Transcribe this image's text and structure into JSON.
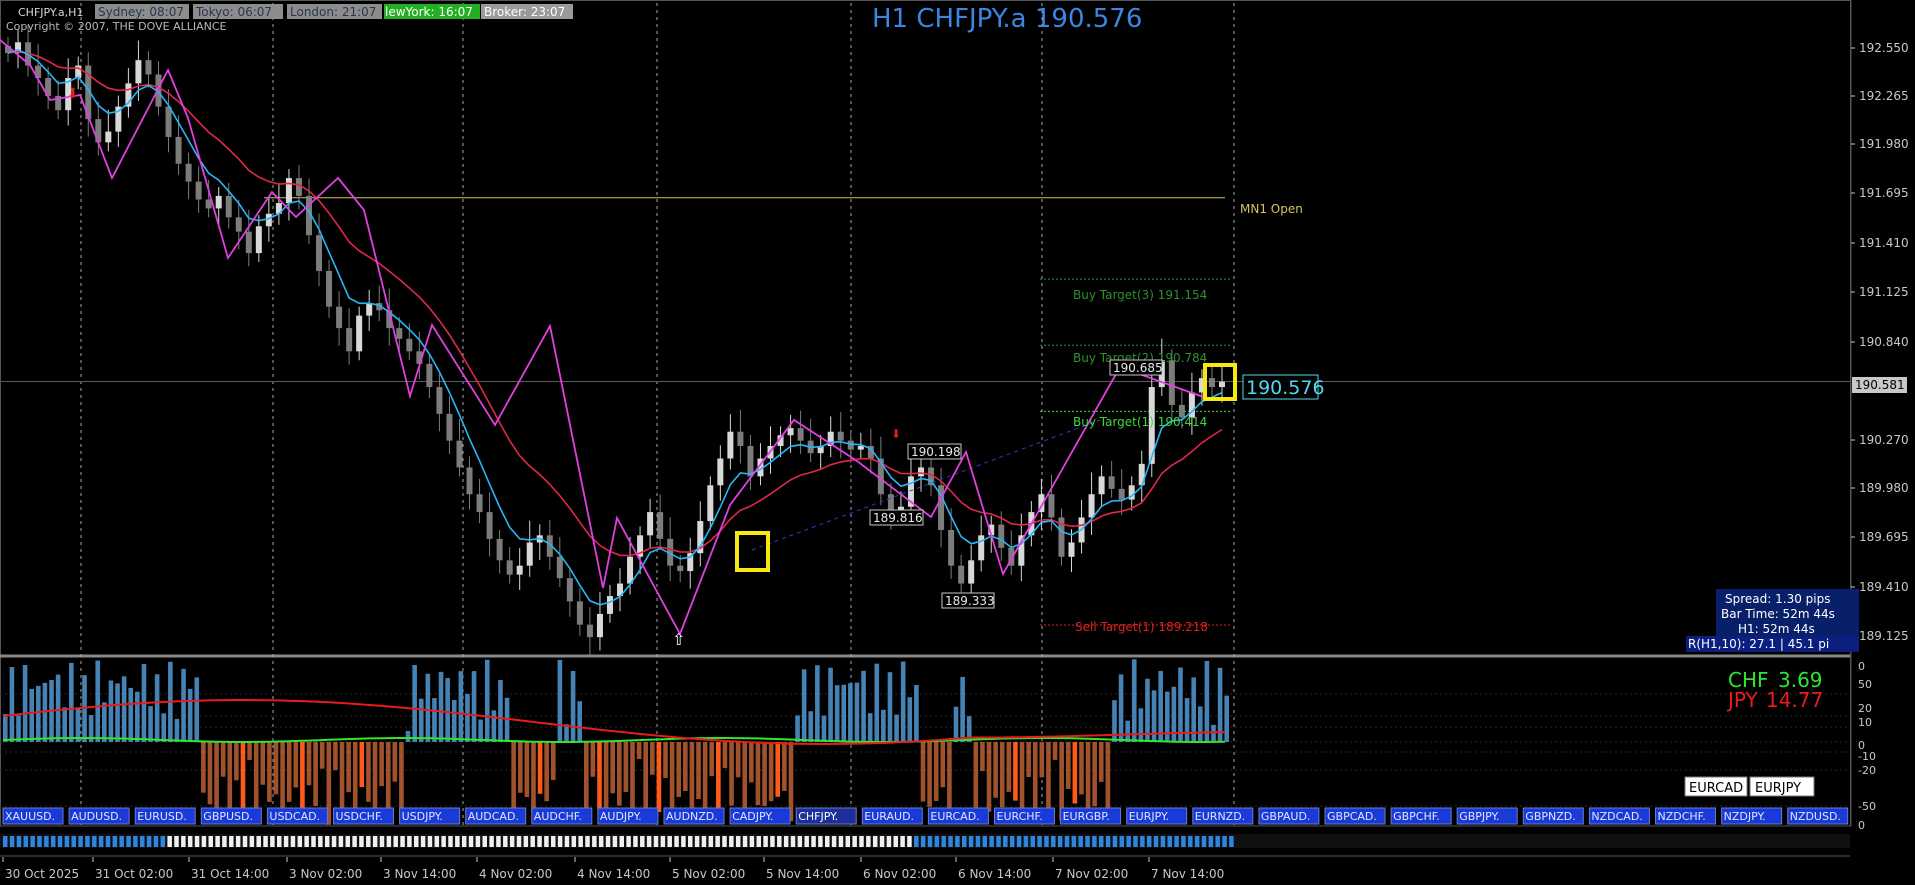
{
  "window": {
    "symbol_label": "CHFJPY.a,H1",
    "copyright": "Copyright © 2007, THE DOVE ALLIANCE",
    "big_title": "H1 CHFJPY.a 190.576"
  },
  "sessions": [
    {
      "label": "Sydney: 08:07",
      "bg": "#8c8c8c",
      "fg": "#2a3550"
    },
    {
      "label": "Tokyo: 06:07",
      "bg": "#8c8c8c",
      "fg": "#2a3550"
    },
    {
      "label": "London: 21:07",
      "bg": "#8c8c8c",
      "fg": "#2a3550"
    },
    {
      "label": "lewYork: 16:07",
      "bg": "#22b022",
      "fg": "#ffffff"
    },
    {
      "label": "Broker: 23:07",
      "bg": "#9a9a9a",
      "fg": "#ffffff"
    }
  ],
  "price_axis": {
    "ticks": [
      "192.550",
      "192.265",
      "191.980",
      "191.695",
      "191.410",
      "191.125",
      "190.840",
      "190.581",
      "190.270",
      "189.980",
      "189.695",
      "189.410",
      "189.125"
    ],
    "current_price": "190.581"
  },
  "levels": {
    "mn1_open": "MN1 Open",
    "buy_target_3": "Buy Target(3) 191.154",
    "buy_target_2": "Buy Target(2) 190.784",
    "buy_target_1": "Buy Target(1) 190.414",
    "sell_target_1": "Sell Target(1) 189.218",
    "current_price_label": "190.576"
  },
  "zigzag_labels": [
    "190.685",
    "190.198",
    "189.816",
    "189.333"
  ],
  "info_panel": {
    "spread": "Spread: 1.30 pips",
    "bar_time": "Bar Time: 52m 44s",
    "h1_time": "H1:  52m 44s",
    "atr": "R(H1,10): 27.1  |  45.1 pi"
  },
  "currency_strength": [
    {
      "label": "CHF",
      "value": "3.69",
      "color": "#2ee82e"
    },
    {
      "label": "JPY",
      "value": "14.77",
      "color": "#e81c1c"
    }
  ],
  "osc_axis": [
    "0",
    "50",
    "20",
    "10",
    "0",
    "-10",
    "-20",
    "-50",
    "0"
  ],
  "quick_buttons": [
    "EURCAD",
    "EURJPY"
  ],
  "pairs": [
    "XAUUSD.",
    "AUDUSD.",
    "EURUSD.",
    "GBPUSD.",
    "USDCAD.",
    "USDCHF.",
    "USDJPY.",
    "AUDCAD.",
    "AUDCHF.",
    "AUDJPY.",
    "AUDNZD.",
    "CADJPY.",
    "CHFJPY.",
    "EURAUD.",
    "EURCAD.",
    "EURCHF.",
    "EURGBP.",
    "EURJPY.",
    "EURNZD.",
    "GBPAUD.",
    "GBPCAD.",
    "GBPCHF.",
    "GBPJPY.",
    "GBPNZD.",
    "NZDCAD.",
    "NZDCHF.",
    "NZDJPY.",
    "NZDUSD."
  ],
  "active_pair": "CHFJPY.",
  "time_axis": [
    "30 Oct 2025",
    "31 Oct 02:00",
    "31 Oct 14:00",
    "3 Nov 02:00",
    "3 Nov 14:00",
    "4 Nov 02:00",
    "4 Nov 14:00",
    "5 Nov 02:00",
    "5 Nov 14:00",
    "6 Nov 02:00",
    "6 Nov 14:00",
    "7 Nov 02:00",
    "7 Nov 14:00"
  ],
  "colors": {
    "bg": "#000000",
    "bull_candle": "#d8d8d8",
    "bear_candle": "#7c7c7c",
    "zigzag": "#e040e0",
    "ma_red": "#e0284a",
    "ma_blue": "#29b6f6",
    "mn1_line": "#d8c060",
    "buy_target": "#2f8f2f",
    "buy_target_1": "#3ed83e",
    "sell_target": "#e02020",
    "highlight_box": "#f5e90d",
    "current_price": "#52d8f0",
    "title_blue": "#3a86e0",
    "hist_pos": "#4682b4",
    "hist_neg": "#a0522d",
    "hist_neg_bright": "#ff5a1a",
    "osc_green": "#2ee82e",
    "osc_red": "#e81c1c",
    "panel_bg": "#08206a",
    "timeline_blue": "#2f86e0"
  },
  "chart_data": {
    "type": "candlestick",
    "symbol": "CHFJPY.a",
    "timeframe": "H1",
    "ylim": [
      189.05,
      192.7
    ],
    "close": [
      192.42,
      192.48,
      192.35,
      192.28,
      192.18,
      192.1,
      192.28,
      192.35,
      192.05,
      191.92,
      191.98,
      192.12,
      192.25,
      192.38,
      192.3,
      192.12,
      191.95,
      191.8,
      191.7,
      191.6,
      191.55,
      191.62,
      191.5,
      191.42,
      191.3,
      191.45,
      191.52,
      191.58,
      191.72,
      191.62,
      191.4,
      191.2,
      191.0,
      190.88,
      190.75,
      190.95,
      191.02,
      190.98,
      190.88,
      190.82,
      190.75,
      190.68,
      190.55,
      190.4,
      190.25,
      190.1,
      189.95,
      189.85,
      189.7,
      189.58,
      189.5,
      189.55,
      189.68,
      189.72,
      189.6,
      189.48,
      189.35,
      189.22,
      189.15,
      189.28,
      189.38,
      189.45,
      189.6,
      189.72,
      189.85,
      189.7,
      189.55,
      189.52,
      189.62,
      189.8,
      190.0,
      190.15,
      190.3,
      190.22,
      190.05,
      190.15,
      190.22,
      190.28,
      190.32,
      190.25,
      190.18,
      190.22,
      190.3,
      190.25,
      190.2,
      190.22,
      190.15,
      189.95,
      189.85,
      189.88,
      190.05,
      190.1,
      190.0,
      189.75,
      189.55,
      189.45,
      189.58,
      189.72,
      189.78,
      189.65,
      189.55,
      189.72,
      189.85,
      189.95,
      189.82,
      189.6,
      189.68,
      189.82,
      189.95,
      190.05,
      189.98,
      189.92,
      190.0,
      190.12,
      190.55,
      190.7,
      190.45,
      190.38,
      190.52,
      190.6,
      190.55,
      190.58
    ]
  }
}
